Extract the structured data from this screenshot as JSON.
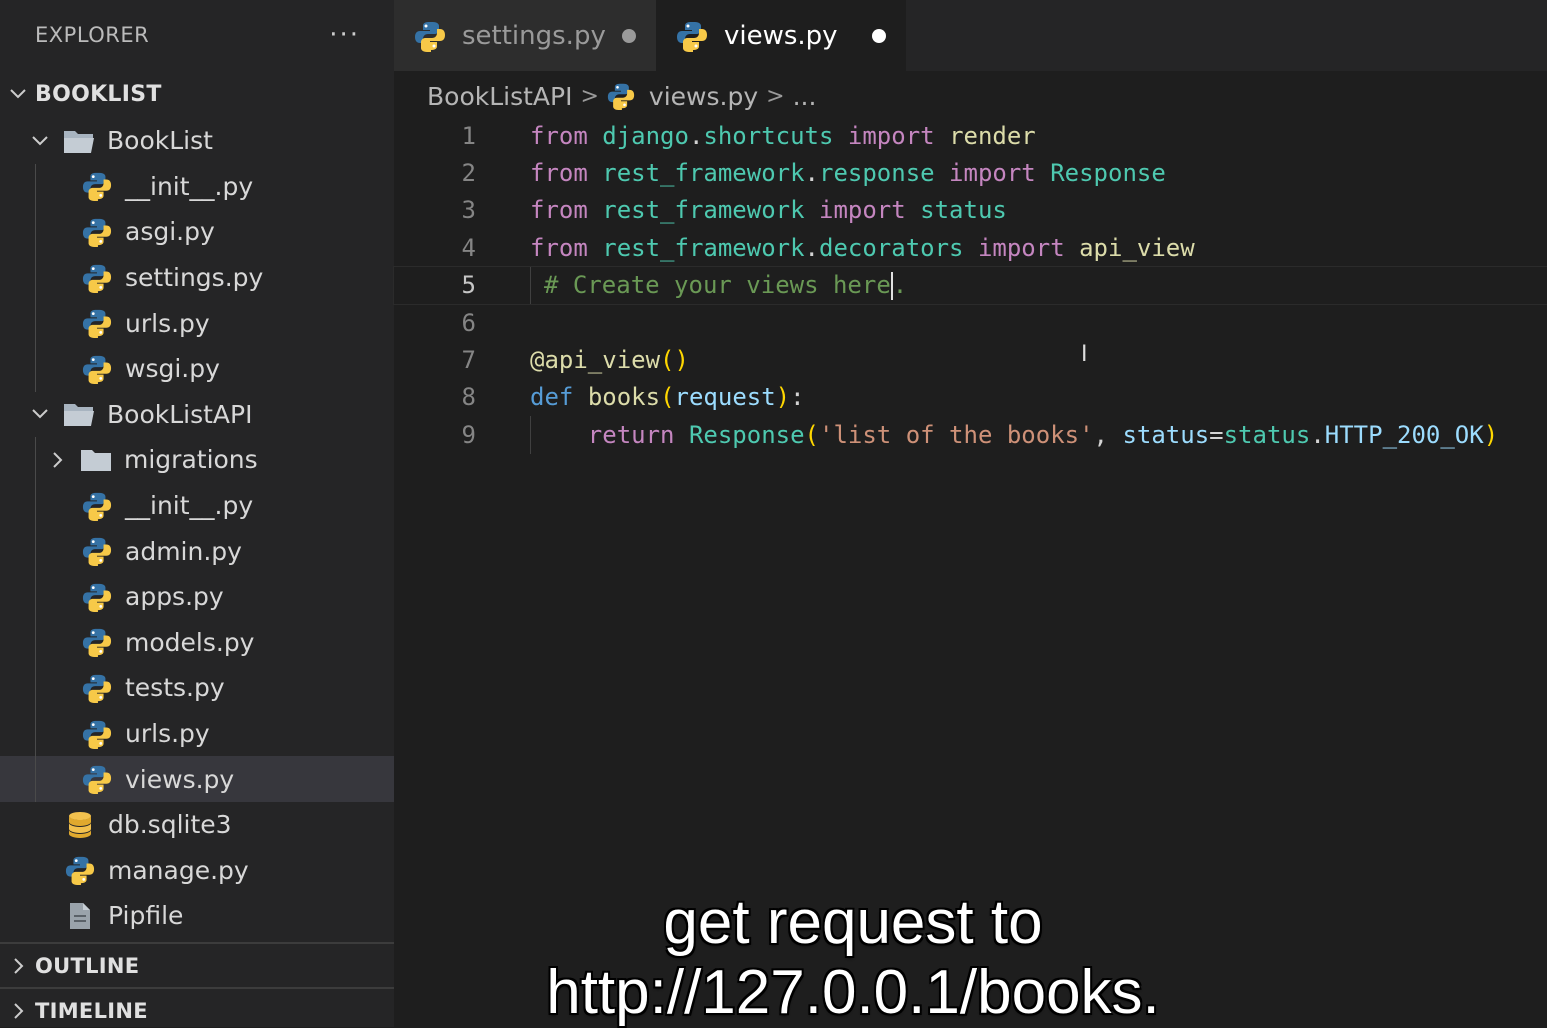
{
  "explorer": {
    "title": "EXPLORER",
    "more_label": "···",
    "root_label": "BOOKLIST",
    "tree": [
      {
        "label": "BookList",
        "type": "folder-open",
        "depth": 0
      },
      {
        "label": "__init__.py",
        "type": "python",
        "depth": 1
      },
      {
        "label": "asgi.py",
        "type": "python",
        "depth": 1
      },
      {
        "label": "settings.py",
        "type": "python",
        "depth": 1
      },
      {
        "label": "urls.py",
        "type": "python",
        "depth": 1
      },
      {
        "label": "wsgi.py",
        "type": "python",
        "depth": 1
      },
      {
        "label": "BookListAPI",
        "type": "folder-open",
        "depth": 0
      },
      {
        "label": "migrations",
        "type": "folder-closed",
        "depth": 1
      },
      {
        "label": "__init__.py",
        "type": "python",
        "depth": 1
      },
      {
        "label": "admin.py",
        "type": "python",
        "depth": 1
      },
      {
        "label": "apps.py",
        "type": "python",
        "depth": 1
      },
      {
        "label": "models.py",
        "type": "python",
        "depth": 1
      },
      {
        "label": "tests.py",
        "type": "python",
        "depth": 1
      },
      {
        "label": "urls.py",
        "type": "python",
        "depth": 1
      },
      {
        "label": "views.py",
        "type": "python",
        "depth": 1,
        "selected": true
      },
      {
        "label": "db.sqlite3",
        "type": "database",
        "depth": 0
      },
      {
        "label": "manage.py",
        "type": "python",
        "depth": 0
      },
      {
        "label": "Pipfile",
        "type": "file",
        "depth": 0
      }
    ],
    "outline_label": "OUTLINE",
    "timeline_label": "TIMELINE"
  },
  "tabs": [
    {
      "label": "settings.py",
      "active": false,
      "modified": true
    },
    {
      "label": "views.py",
      "active": true,
      "modified": true
    }
  ],
  "breadcrumb": {
    "folder": "BookListAPI",
    "file": "views.py",
    "tail": "..."
  },
  "code_lines": [
    {
      "n": "1",
      "tokens": [
        [
          "kw",
          "from"
        ],
        [
          "txt",
          " "
        ],
        [
          "mod",
          "django"
        ],
        [
          "txt",
          "."
        ],
        [
          "mod",
          "shortcuts"
        ],
        [
          "txt",
          " "
        ],
        [
          "kw",
          "import"
        ],
        [
          "txt",
          " "
        ],
        [
          "fn",
          "render"
        ]
      ]
    },
    {
      "n": "2",
      "tokens": [
        [
          "kw",
          "from"
        ],
        [
          "txt",
          " "
        ],
        [
          "mod",
          "rest_framework"
        ],
        [
          "txt",
          "."
        ],
        [
          "mod",
          "response"
        ],
        [
          "txt",
          " "
        ],
        [
          "kw",
          "import"
        ],
        [
          "txt",
          " "
        ],
        [
          "mod2",
          "Response"
        ]
      ]
    },
    {
      "n": "3",
      "tokens": [
        [
          "kw",
          "from"
        ],
        [
          "txt",
          " "
        ],
        [
          "mod",
          "rest_framework"
        ],
        [
          "txt",
          " "
        ],
        [
          "kw",
          "import"
        ],
        [
          "txt",
          " "
        ],
        [
          "mod",
          "status"
        ]
      ]
    },
    {
      "n": "4",
      "tokens": [
        [
          "kw",
          "from"
        ],
        [
          "txt",
          " "
        ],
        [
          "mod",
          "rest_framework"
        ],
        [
          "txt",
          "."
        ],
        [
          "mod",
          "decorators"
        ],
        [
          "txt",
          " "
        ],
        [
          "kw",
          "import"
        ],
        [
          "txt",
          " "
        ],
        [
          "fn",
          "api_view"
        ]
      ]
    },
    {
      "n": "5",
      "current": true,
      "tokens": [
        [
          "cmt",
          "# Create your views here"
        ],
        [
          "caret",
          ""
        ],
        [
          "cmt",
          "."
        ]
      ]
    },
    {
      "n": "6",
      "tokens": []
    },
    {
      "n": "7",
      "tokens": [
        [
          "fn",
          "@api_view"
        ],
        [
          "brk",
          "()"
        ]
      ]
    },
    {
      "n": "8",
      "tokens": [
        [
          "kw2",
          "def"
        ],
        [
          "txt",
          " "
        ],
        [
          "fn",
          "books"
        ],
        [
          "brk",
          "("
        ],
        [
          "par",
          "request"
        ],
        [
          "brk",
          ")"
        ],
        [
          "txt",
          ":"
        ]
      ]
    },
    {
      "n": "9",
      "indent": true,
      "tokens": [
        [
          "txt",
          "    "
        ],
        [
          "kw",
          "return"
        ],
        [
          "txt",
          " "
        ],
        [
          "mod2",
          "Response"
        ],
        [
          "brk",
          "("
        ],
        [
          "str",
          "'list of the books'"
        ],
        [
          "txt",
          ", "
        ],
        [
          "par",
          "status"
        ],
        [
          "txt",
          "="
        ],
        [
          "mod",
          "status"
        ],
        [
          "txt",
          "."
        ],
        [
          "par",
          "HTTP_200_OK"
        ],
        [
          "brk",
          ")"
        ]
      ]
    }
  ],
  "caption": {
    "line1": "get request to",
    "line2": "http://127.0.0.1/books."
  }
}
